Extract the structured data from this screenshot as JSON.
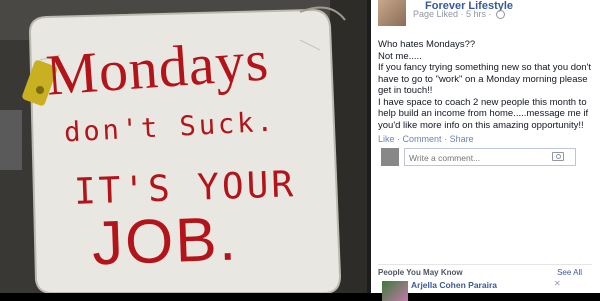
{
  "page": {
    "name": "Forever Lifestyle",
    "meta": "Page Liked · 5 hrs ·"
  },
  "photo": {
    "line1": "Mondays",
    "line2": "don't Suck.",
    "line3": "IT'S YOUR",
    "line4": "JOB."
  },
  "post": {
    "lines": [
      "Who hates Mondays??",
      "Not me.....",
      "If you fancy trying something new so that you don't have to go to \"work\" on a Monday morning please get in touch!!",
      "I have space to coach 2 new people this month to help build an income from home.....message me if you'd like more info on this amazing opportunity!!"
    ]
  },
  "actions": {
    "like": "Like",
    "comment": "Comment",
    "share": "Share"
  },
  "comment": {
    "placeholder": "Write a comment..."
  },
  "pymk": {
    "title": "People You May Know",
    "see_all": "See All",
    "person": "Arjella Cohen Paraira",
    "close": "✕"
  },
  "colors": {
    "link": "#3b5998",
    "paint": "#b3141a"
  },
  "icons": [
    "globe-icon",
    "camera-icon",
    "close-icon"
  ]
}
